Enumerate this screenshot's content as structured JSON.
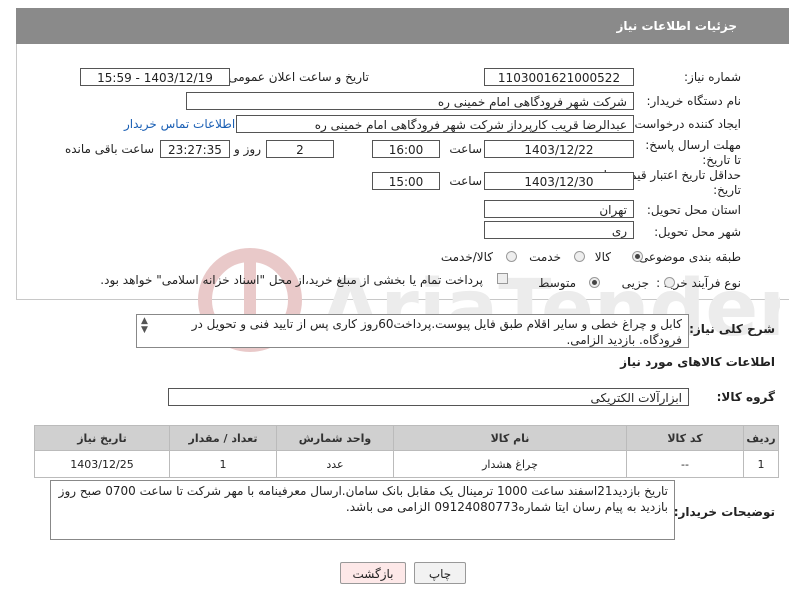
{
  "header": {
    "title": "جزئیات اطلاعات نیاز"
  },
  "form": {
    "need_number_label": "شماره نیاز:",
    "need_number": "1103001621000522",
    "announce_label": "تاریخ و ساعت اعلان عمومی:",
    "announce_value": "1403/12/19 - 15:59",
    "buyer_org_label": "نام دستگاه خریدار:",
    "buyer_org": "شرکت شهر فرودگاهی امام خمینی  ره",
    "creator_label": "ایجاد کننده درخواست:",
    "creator": "عبدالرضا قریب کارپرداز شرکت شهر فرودگاهی امام خمینی  ره",
    "contact_link": "اطلاعات تماس خریدار",
    "deadline_label": "مهلت ارسال پاسخ: تا تاریخ:",
    "deadline_date": "1403/12/22",
    "time_label": "ساعت",
    "deadline_time": "16:00",
    "days_value": "2",
    "days_label": "روز و",
    "remaining_time": "23:27:35",
    "remaining_label": "ساعت باقی مانده",
    "validity_label": "حداقل تاریخ اعتبار قیمت: تا تاریخ:",
    "validity_date": "1403/12/30",
    "validity_time": "15:00",
    "province_label": "استان محل تحویل:",
    "province": "تهران",
    "city_label": "شهر محل تحویل:",
    "city": "ری",
    "category_label": "طبقه بندی موضوعی:",
    "category_options": [
      "کالا",
      "خدمت",
      "کالا/خدمت"
    ],
    "process_label": "نوع فرآیند خرید :",
    "process_options": [
      "جزیی",
      "متوسط"
    ],
    "payment_note": "پرداخت تمام یا بخشی از مبلغ خرید،از محل \"اسناد خزانه اسلامی\" خواهد بود."
  },
  "summary": {
    "label": "شرح کلی نیاز:",
    "text": "کابل و چراغ خطی و سایر اقلام طبق فایل پیوست.پرداخت60روز کاری پس از تایید فنی و تحویل در فرودگاه. بازدید الزامی."
  },
  "goods": {
    "section_title": "اطلاعات کالاهای مورد نیاز",
    "group_label": "گروه کالا:",
    "group_value": "ابزارآلات الکتریکی",
    "columns": [
      "ردیف",
      "کد کالا",
      "نام کالا",
      "واحد شمارش",
      "تعداد / مقدار",
      "تاریخ نیاز"
    ],
    "rows": [
      [
        "1",
        "--",
        "چراغ هشدار",
        "عدد",
        "1",
        "1403/12/25"
      ]
    ]
  },
  "buyer_notes": {
    "label": "توضیحات خریدار:",
    "text": "تاریخ بازدید21اسفند ساعت 1000 ترمینال یک مقابل بانک سامان.ارسال معرفینامه با مهر شرکت تا ساعت 0700 صبح روز بازدید به پیام رسان ایتا شماره09124080773 الزامی می باشد."
  },
  "buttons": {
    "print": "چاپ",
    "back": "بازگشت"
  },
  "colors": {
    "header_bg": "#8a8a8a",
    "back_bg": "#fde8e8",
    "link": "#1a5fb4"
  }
}
